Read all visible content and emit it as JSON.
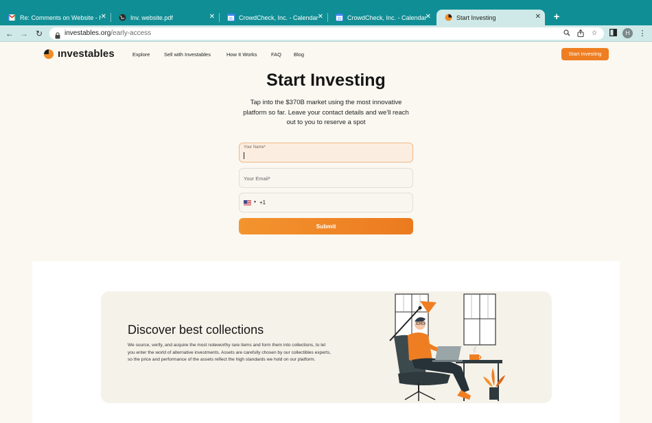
{
  "browser": {
    "tabs": [
      {
        "title": "Re: Comments on Website - he",
        "icon": "gmail-icon",
        "active": false
      },
      {
        "title": "Inv. website.pdf",
        "icon": "globe-icon",
        "active": false
      },
      {
        "title": "CrowdCheck, Inc. - Calendar -",
        "icon": "calendar-icon",
        "active": false
      },
      {
        "title": "CrowdCheck, Inc. - Calendar -",
        "icon": "calendar-icon",
        "active": false
      },
      {
        "title": "Start Investing",
        "icon": "investables-icon",
        "active": true
      }
    ],
    "url_domain": "investables.org",
    "url_path": "/early-access",
    "profile_initial": "H"
  },
  "site": {
    "logo_text": "ınvestables",
    "nav": [
      "Explore",
      "Sell with Investables",
      "How It Works",
      "FAQ",
      "Blog"
    ],
    "cta": "Start Investing",
    "accent": "#ef7e22"
  },
  "hero": {
    "title": "Start Investing",
    "subtitle": "Tap into the $370B market using the most innovative platform so far. Leave your contact details and we'll reach out to you to reserve a spot"
  },
  "form": {
    "name_label": "Your Name*",
    "email_placeholder": "Your Email*",
    "phone_prefix": "+1",
    "submit": "Submit"
  },
  "collections": {
    "title": "Discover best collections",
    "text": "We source, verify, and acquire the most noteworthy rare items and form them into collections, to let you enter the world of alternative investments. Assets are carefully chosen by our collectibles experts, so the price and performance of the assets reflect the high standards we hold on our platform."
  }
}
